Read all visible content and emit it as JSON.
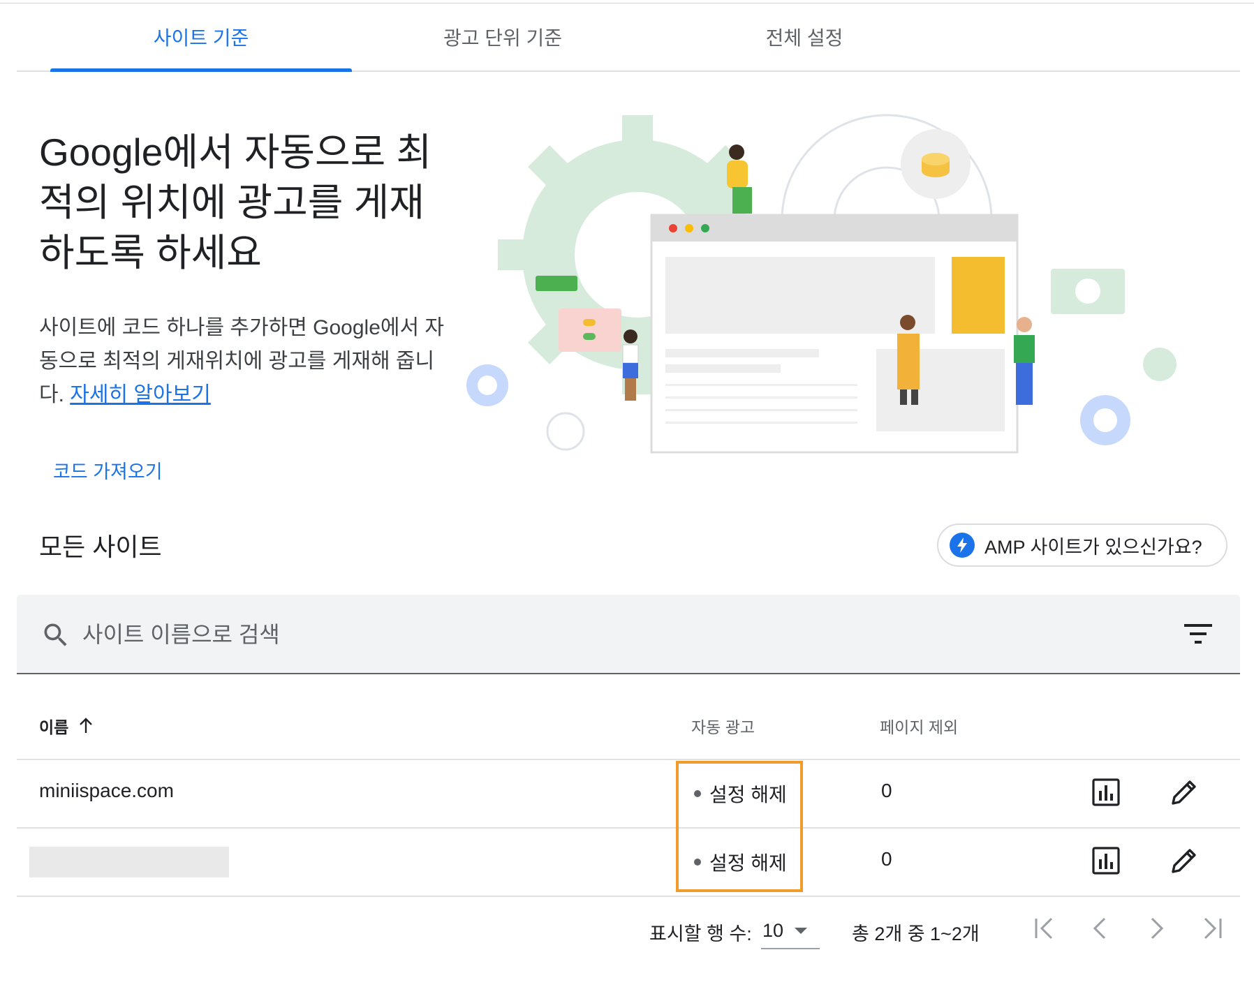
{
  "tabs": [
    {
      "label": "사이트 기준",
      "active": true
    },
    {
      "label": "광고 단위 기준",
      "active": false
    },
    {
      "label": "전체 설정",
      "active": false
    }
  ],
  "hero": {
    "title": "Google에서 자동으로 최적의 위치에 광고를 게재하도록 하세요",
    "description": "사이트에 코드 하나를 추가하면 Google에서 자동으로 최적의 게재위치에 광고를 게재해 줍니다.",
    "learn_more": "자세히 알아보기",
    "get_code": "코드 가져오기"
  },
  "sites_section": {
    "title": "모든 사이트",
    "amp_button": "AMP 사이트가 있으신가요?"
  },
  "search": {
    "placeholder": "사이트 이름으로 검색",
    "icon": "search-icon",
    "filter_icon": "filter-icon"
  },
  "table": {
    "columns": {
      "name": "이름",
      "auto_ads": "자동 광고",
      "excluded_pages": "페이지 제외"
    },
    "sort_icon": "arrow-up-icon",
    "rows": [
      {
        "name": "miniispace.com",
        "status": "설정 해제",
        "excluded": "0"
      },
      {
        "name": "",
        "status": "설정 해제",
        "excluded": "0",
        "redacted": true
      }
    ]
  },
  "pagination": {
    "rows_per_page_label": "표시할 행 수:",
    "rows_per_page": "10",
    "range": "총 2개 중 1~2개"
  },
  "colors": {
    "accent": "#1a73e8",
    "highlight": "#f29b2d",
    "search_bg": "#f1f3f4"
  }
}
